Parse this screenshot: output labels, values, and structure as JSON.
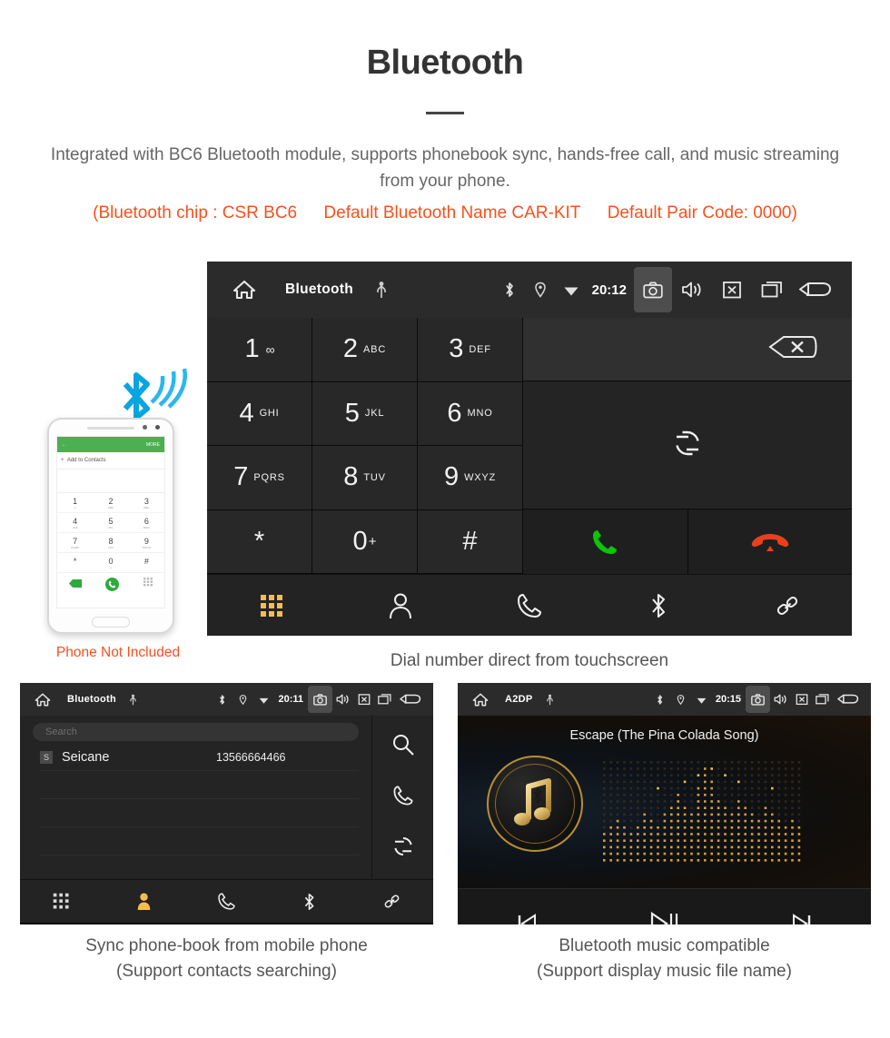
{
  "header": {
    "title": "Bluetooth",
    "description": "Integrated with BC6 Bluetooth module, supports phonebook sync, hands-free call, and music streaming from your phone.",
    "spec_chip": "(Bluetooth chip : CSR BC6",
    "spec_name": "Default Bluetooth Name CAR-KIT",
    "spec_pair": "Default Pair Code: 0000)"
  },
  "accent_colors": {
    "orange": "#f4511e",
    "amber": "#f5bd4f",
    "call_green": "#0cc40c",
    "end_red": "#e8401c",
    "bluetooth_blue": "#0aa5e0",
    "gold": "#c69a3d"
  },
  "dialer_unit": {
    "statusbar": {
      "home_icon": "home-icon",
      "title": "Bluetooth",
      "usb_icon": "usb-icon",
      "bluetooth_icon": "bluetooth-icon",
      "location_icon": "location-pin-icon",
      "wifi_icon": "wifi-icon",
      "clock": "20:12",
      "camera_icon": "camera-icon",
      "volume_icon": "volume-icon",
      "close_icon": "close-box-icon",
      "recents_icon": "recents-icon",
      "back_icon": "back-arrow-icon"
    },
    "keys": [
      {
        "num": "1",
        "sub": "",
        "voicemail": "∞"
      },
      {
        "num": "2",
        "sub": "ABC"
      },
      {
        "num": "3",
        "sub": "DEF"
      },
      {
        "num": "4",
        "sub": "GHI"
      },
      {
        "num": "5",
        "sub": "JKL"
      },
      {
        "num": "6",
        "sub": "MNO"
      },
      {
        "num": "7",
        "sub": "PQRS"
      },
      {
        "num": "8",
        "sub": "TUV"
      },
      {
        "num": "9",
        "sub": "WXYZ"
      },
      {
        "num": "*",
        "sub": ""
      },
      {
        "num": "0",
        "sup": "+"
      },
      {
        "num": "#",
        "sub": ""
      }
    ],
    "actions": {
      "backspace_icon": "backspace-icon",
      "sync_icon": "sync-icon",
      "call_icon": "call-icon",
      "hangup_icon": "hangup-icon"
    },
    "bottom_nav": [
      {
        "name": "dialpad",
        "icon": "dialpad-icon",
        "active": true
      },
      {
        "name": "contacts",
        "icon": "contact-person-icon",
        "active": false
      },
      {
        "name": "call-log",
        "icon": "phone-handset-icon",
        "active": false
      },
      {
        "name": "bluetooth",
        "icon": "bluetooth-icon",
        "active": false
      },
      {
        "name": "pair-link",
        "icon": "link-icon",
        "active": false
      }
    ],
    "caption": "Dial number direct from touchscreen"
  },
  "phone_illustration": {
    "bluetooth_icon": "bluetooth-signal-icon",
    "appbar_back": "←",
    "appbar_more": "MORE",
    "add_contacts": "Add to Contacts",
    "keys": [
      {
        "num": "1",
        "sub": "∞"
      },
      {
        "num": "2",
        "sub": "ABC"
      },
      {
        "num": "3",
        "sub": "DEF"
      },
      {
        "num": "4",
        "sub": "GHI"
      },
      {
        "num": "5",
        "sub": "JKL"
      },
      {
        "num": "6",
        "sub": "MNO"
      },
      {
        "num": "7",
        "sub": "PQRS"
      },
      {
        "num": "8",
        "sub": "TUV"
      },
      {
        "num": "9",
        "sub": "WXYZ"
      },
      {
        "num": "*",
        "sub": ""
      },
      {
        "num": "0",
        "sub": "+"
      },
      {
        "num": "#",
        "sub": ""
      }
    ],
    "note": "Phone Not Included"
  },
  "phonebook_unit": {
    "statusbar": {
      "title": "Bluetooth",
      "clock": "20:11"
    },
    "search_placeholder": "Search",
    "contacts": [
      {
        "initial": "S",
        "name": "Seicane",
        "number": "13566664466"
      }
    ],
    "side_actions": [
      {
        "name": "search",
        "icon": "search-icon"
      },
      {
        "name": "call",
        "icon": "phone-handset-icon"
      },
      {
        "name": "sync",
        "icon": "sync-icon"
      }
    ],
    "bottom_nav": [
      {
        "name": "dialpad",
        "icon": "dialpad-icon",
        "active": false
      },
      {
        "name": "contacts",
        "icon": "contact-person-icon",
        "active": true
      },
      {
        "name": "call-log",
        "icon": "phone-handset-icon",
        "active": false
      },
      {
        "name": "bluetooth",
        "icon": "bluetooth-icon",
        "active": false
      },
      {
        "name": "pair-link",
        "icon": "link-icon",
        "active": false
      }
    ],
    "caption_line1": "Sync phone-book from mobile phone",
    "caption_line2": "(Support contacts searching)"
  },
  "music_unit": {
    "statusbar": {
      "title": "A2DP",
      "clock": "20:15"
    },
    "song_title": "Escape (The Pina Colada Song)",
    "album_icon": "music-note-bluetooth-icon",
    "visualizer": "dot-matrix-equalizer",
    "controls": [
      {
        "name": "previous",
        "icon": "previous-track-icon"
      },
      {
        "name": "play-pause",
        "icon": "play-pause-icon"
      },
      {
        "name": "next",
        "icon": "next-track-icon"
      }
    ],
    "caption_line1": "Bluetooth music compatible",
    "caption_line2": "(Support display music file name)"
  }
}
